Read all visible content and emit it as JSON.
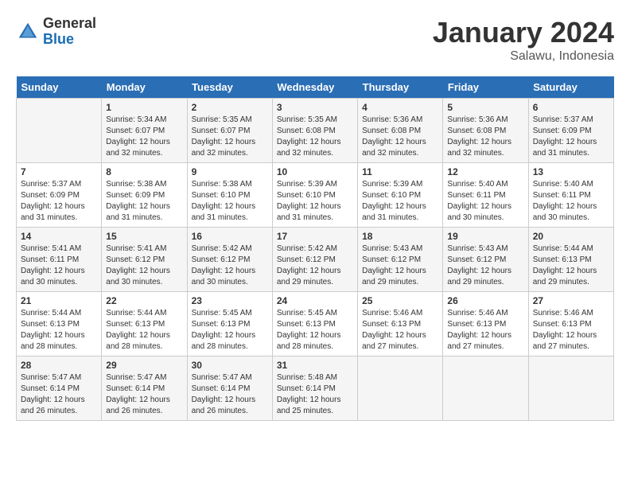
{
  "header": {
    "logo_general": "General",
    "logo_blue": "Blue",
    "month": "January 2024",
    "location": "Salawu, Indonesia"
  },
  "days_of_week": [
    "Sunday",
    "Monday",
    "Tuesday",
    "Wednesday",
    "Thursday",
    "Friday",
    "Saturday"
  ],
  "weeks": [
    [
      {
        "day": "",
        "info": ""
      },
      {
        "day": "1",
        "info": "Sunrise: 5:34 AM\nSunset: 6:07 PM\nDaylight: 12 hours\nand 32 minutes."
      },
      {
        "day": "2",
        "info": "Sunrise: 5:35 AM\nSunset: 6:07 PM\nDaylight: 12 hours\nand 32 minutes."
      },
      {
        "day": "3",
        "info": "Sunrise: 5:35 AM\nSunset: 6:08 PM\nDaylight: 12 hours\nand 32 minutes."
      },
      {
        "day": "4",
        "info": "Sunrise: 5:36 AM\nSunset: 6:08 PM\nDaylight: 12 hours\nand 32 minutes."
      },
      {
        "day": "5",
        "info": "Sunrise: 5:36 AM\nSunset: 6:08 PM\nDaylight: 12 hours\nand 32 minutes."
      },
      {
        "day": "6",
        "info": "Sunrise: 5:37 AM\nSunset: 6:09 PM\nDaylight: 12 hours\nand 31 minutes."
      }
    ],
    [
      {
        "day": "7",
        "info": "Sunrise: 5:37 AM\nSunset: 6:09 PM\nDaylight: 12 hours\nand 31 minutes."
      },
      {
        "day": "8",
        "info": "Sunrise: 5:38 AM\nSunset: 6:09 PM\nDaylight: 12 hours\nand 31 minutes."
      },
      {
        "day": "9",
        "info": "Sunrise: 5:38 AM\nSunset: 6:10 PM\nDaylight: 12 hours\nand 31 minutes."
      },
      {
        "day": "10",
        "info": "Sunrise: 5:39 AM\nSunset: 6:10 PM\nDaylight: 12 hours\nand 31 minutes."
      },
      {
        "day": "11",
        "info": "Sunrise: 5:39 AM\nSunset: 6:10 PM\nDaylight: 12 hours\nand 31 minutes."
      },
      {
        "day": "12",
        "info": "Sunrise: 5:40 AM\nSunset: 6:11 PM\nDaylight: 12 hours\nand 30 minutes."
      },
      {
        "day": "13",
        "info": "Sunrise: 5:40 AM\nSunset: 6:11 PM\nDaylight: 12 hours\nand 30 minutes."
      }
    ],
    [
      {
        "day": "14",
        "info": "Sunrise: 5:41 AM\nSunset: 6:11 PM\nDaylight: 12 hours\nand 30 minutes."
      },
      {
        "day": "15",
        "info": "Sunrise: 5:41 AM\nSunset: 6:12 PM\nDaylight: 12 hours\nand 30 minutes."
      },
      {
        "day": "16",
        "info": "Sunrise: 5:42 AM\nSunset: 6:12 PM\nDaylight: 12 hours\nand 30 minutes."
      },
      {
        "day": "17",
        "info": "Sunrise: 5:42 AM\nSunset: 6:12 PM\nDaylight: 12 hours\nand 29 minutes."
      },
      {
        "day": "18",
        "info": "Sunrise: 5:43 AM\nSunset: 6:12 PM\nDaylight: 12 hours\nand 29 minutes."
      },
      {
        "day": "19",
        "info": "Sunrise: 5:43 AM\nSunset: 6:12 PM\nDaylight: 12 hours\nand 29 minutes."
      },
      {
        "day": "20",
        "info": "Sunrise: 5:44 AM\nSunset: 6:13 PM\nDaylight: 12 hours\nand 29 minutes."
      }
    ],
    [
      {
        "day": "21",
        "info": "Sunrise: 5:44 AM\nSunset: 6:13 PM\nDaylight: 12 hours\nand 28 minutes."
      },
      {
        "day": "22",
        "info": "Sunrise: 5:44 AM\nSunset: 6:13 PM\nDaylight: 12 hours\nand 28 minutes."
      },
      {
        "day": "23",
        "info": "Sunrise: 5:45 AM\nSunset: 6:13 PM\nDaylight: 12 hours\nand 28 minutes."
      },
      {
        "day": "24",
        "info": "Sunrise: 5:45 AM\nSunset: 6:13 PM\nDaylight: 12 hours\nand 28 minutes."
      },
      {
        "day": "25",
        "info": "Sunrise: 5:46 AM\nSunset: 6:13 PM\nDaylight: 12 hours\nand 27 minutes."
      },
      {
        "day": "26",
        "info": "Sunrise: 5:46 AM\nSunset: 6:13 PM\nDaylight: 12 hours\nand 27 minutes."
      },
      {
        "day": "27",
        "info": "Sunrise: 5:46 AM\nSunset: 6:13 PM\nDaylight: 12 hours\nand 27 minutes."
      }
    ],
    [
      {
        "day": "28",
        "info": "Sunrise: 5:47 AM\nSunset: 6:14 PM\nDaylight: 12 hours\nand 26 minutes."
      },
      {
        "day": "29",
        "info": "Sunrise: 5:47 AM\nSunset: 6:14 PM\nDaylight: 12 hours\nand 26 minutes."
      },
      {
        "day": "30",
        "info": "Sunrise: 5:47 AM\nSunset: 6:14 PM\nDaylight: 12 hours\nand 26 minutes."
      },
      {
        "day": "31",
        "info": "Sunrise: 5:48 AM\nSunset: 6:14 PM\nDaylight: 12 hours\nand 25 minutes."
      },
      {
        "day": "",
        "info": ""
      },
      {
        "day": "",
        "info": ""
      },
      {
        "day": "",
        "info": ""
      }
    ]
  ]
}
